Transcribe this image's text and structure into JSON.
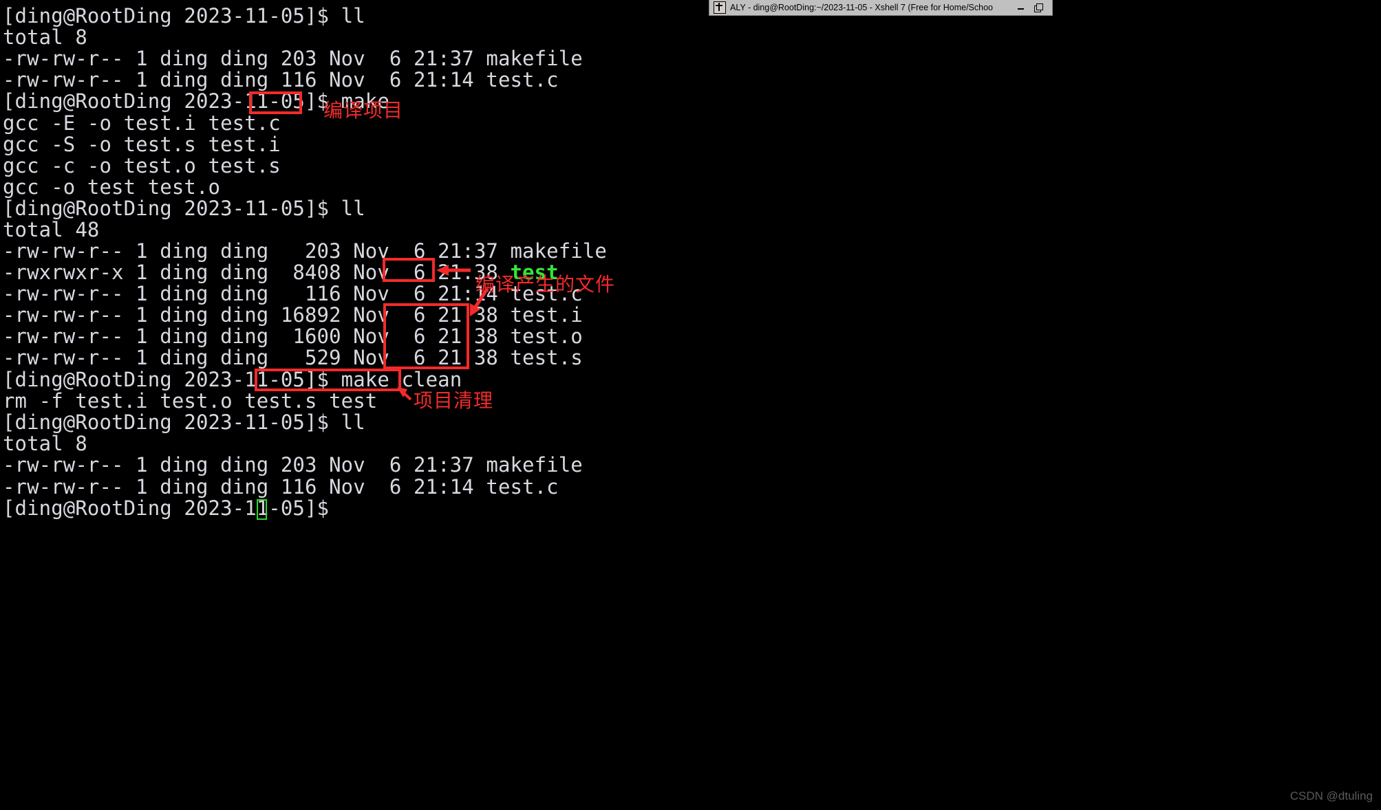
{
  "window": {
    "title": "ALY - ding@RootDing:~/2023-11-05 - Xshell 7 (Free for Home/Schoo",
    "icon": "xshell-icon",
    "minimize_label": "minimize-icon",
    "restore_label": "restore-icon"
  },
  "terminal": {
    "prompt": "[ding@RootDing 2023-11-05]$ ",
    "lines": [
      {
        "text": "[ding@RootDing 2023-11-05]$ ll"
      },
      {
        "text": "total 8"
      },
      {
        "text": "-rw-rw-r-- 1 ding ding 203 Nov  6 21:37 makefile"
      },
      {
        "text": "-rw-rw-r-- 1 ding ding 116 Nov  6 21:14 test.c"
      },
      {
        "text": "[ding@RootDing 2023-11-05]$ make"
      },
      {
        "text": "gcc -E -o test.i test.c"
      },
      {
        "text": "gcc -S -o test.s test.i"
      },
      {
        "text": "gcc -c -o test.o test.s"
      },
      {
        "text": "gcc -o test test.o"
      },
      {
        "text": "[ding@RootDing 2023-11-05]$ ll"
      },
      {
        "text": "total 48"
      },
      {
        "text": "-rw-rw-r-- 1 ding ding   203 Nov  6 21:37 makefile"
      },
      {
        "text": "-rwxrwxr-x 1 ding ding  8408 Nov  6 21:38 ",
        "green_suffix": "test"
      },
      {
        "text": "-rw-rw-r-- 1 ding ding   116 Nov  6 21:14 test.c"
      },
      {
        "text": "-rw-rw-r-- 1 ding ding 16892 Nov  6 21:38 test.i"
      },
      {
        "text": "-rw-rw-r-- 1 ding ding  1600 Nov  6 21:38 test.o"
      },
      {
        "text": "-rw-rw-r-- 1 ding ding   529 Nov  6 21:38 test.s"
      },
      {
        "text": "[ding@RootDing 2023-11-05]$ make clean"
      },
      {
        "text": "rm -f test.i test.o test.s test"
      },
      {
        "text": "[ding@RootDing 2023-11-05]$ ll"
      },
      {
        "text": "total 8"
      },
      {
        "text": "-rw-rw-r-- 1 ding ding 203 Nov  6 21:37 makefile"
      },
      {
        "text": "-rw-rw-r-- 1 ding ding 116 Nov  6 21:14 test.c"
      },
      {
        "text": "[ding@RootDing 2023-11-05]$ "
      }
    ]
  },
  "annotations": [
    {
      "id": "make-note",
      "text": "编译项目"
    },
    {
      "id": "output-files-note",
      "text": "编译产生的文件"
    },
    {
      "id": "clean-note",
      "text": "项目清理"
    }
  ],
  "watermark": "CSDN @dtuling",
  "colors": {
    "terminal_bg": "#000000",
    "terminal_fg": "#d8d8e0",
    "executable_green": "#35e535",
    "annotation_red": "#f42a2a",
    "titlebar_bg": "#c0c0c0",
    "cursor_green": "#2fd82f"
  }
}
